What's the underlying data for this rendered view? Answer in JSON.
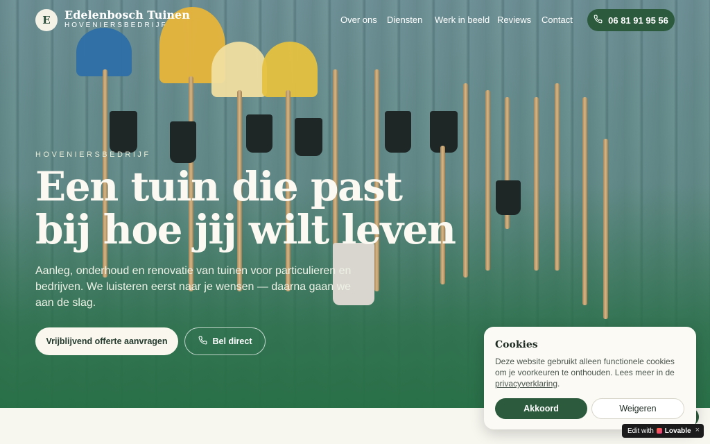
{
  "brand": {
    "badge": "E",
    "name": "Edelenbosch Tuinen",
    "subtitle": "HOVENIERSBEDRIJF"
  },
  "nav": {
    "links": [
      "Over ons",
      "Diensten",
      "Werk in beeld",
      "Reviews",
      "Contact"
    ],
    "phone": "06 81 91 95 56"
  },
  "hero": {
    "eyebrow": "HOVENIERSBEDRIJF",
    "headline": "Een tuin die past bij hoe jij wilt leven",
    "lead": "Aanleg, onderhoud en renovatie van tuinen voor particulieren en bedrijven. We luisteren eerst naar je wensen — daarna gaan we aan de slag.",
    "cta_primary": "Vrijblijvend offerte aanvragen",
    "cta_call": "Bel direct"
  },
  "cookie": {
    "title": "Cookies",
    "text": "Deze website gebruikt alleen functionele cookies om je voorkeuren te onthouden. Lees meer in de ",
    "link": "privacyverklaring",
    "text_end": ".",
    "accept": "Akkoord",
    "decline": "Weigeren"
  },
  "badge": {
    "prefix": "Edit with",
    "brand": "Lovable",
    "close": "×"
  },
  "colors": {
    "primary": "#2b5a3c",
    "cream": "#faf7ee",
    "hero_green": "#26 6e44"
  }
}
